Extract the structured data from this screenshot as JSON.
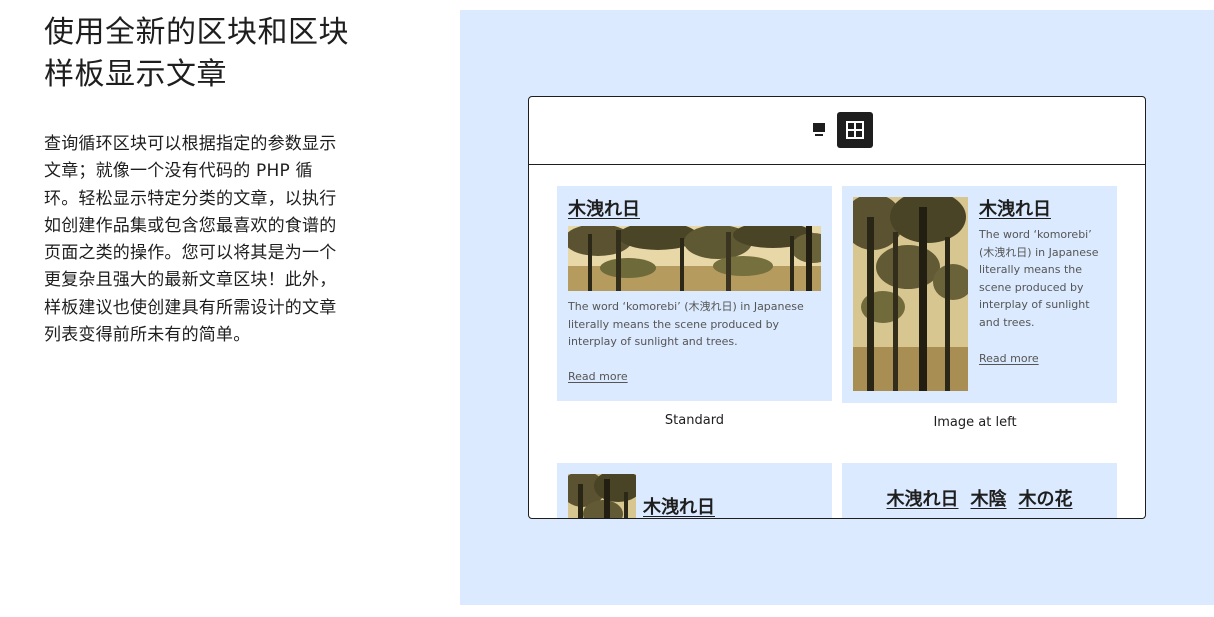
{
  "headline": {
    "line1": "使用全新的区块和区块",
    "line2": "样板显示文章"
  },
  "description": {
    "lines": [
      "查询循环区块可以根据指定的参数显示",
      "文章；就像一个没有代码的 PHP 循",
      "环。轻松显示特定分类的文章，以执行",
      "如创建作品集或包含您最喜欢的食谱的",
      "页面之类的操作。您可以将其是为一个",
      "更复杂且强大的最新文章区块！此外，",
      "样板建议也使创建具有所需设计的文章",
      "列表变得前所未有的简单。"
    ]
  },
  "toolbar": {
    "list_view_icon": "list-view-icon",
    "grid_view_icon": "grid-view-icon"
  },
  "patterns": {
    "standard": {
      "title": "木洩れ日",
      "excerpt_lines": [
        "The word ‘komorebi’ (木洩れ日) in Japanese",
        "literally means the scene produced by",
        "interplay of sunlight and trees."
      ],
      "read_more": "Read more",
      "caption": "Standard"
    },
    "image_left": {
      "title": "木洩れ日",
      "excerpt_lines": [
        "The word ‘komorebi’",
        "(木洩れ日) in Japanese",
        "literally means the",
        "scene produced by",
        "interplay of sunlight",
        "and trees."
      ],
      "read_more": "Read more",
      "caption": "Image at left"
    },
    "small_image": {
      "title": "木洩れ日"
    },
    "titles_only": {
      "titles": [
        "木洩れ日",
        "木陰",
        "木の花"
      ]
    }
  },
  "colors": {
    "panel_bg": "#dbeafe",
    "card_bg": "#dbeafe",
    "text": "#1e1e1e",
    "muted": "#555555",
    "active_button": "#1e1e1e"
  }
}
